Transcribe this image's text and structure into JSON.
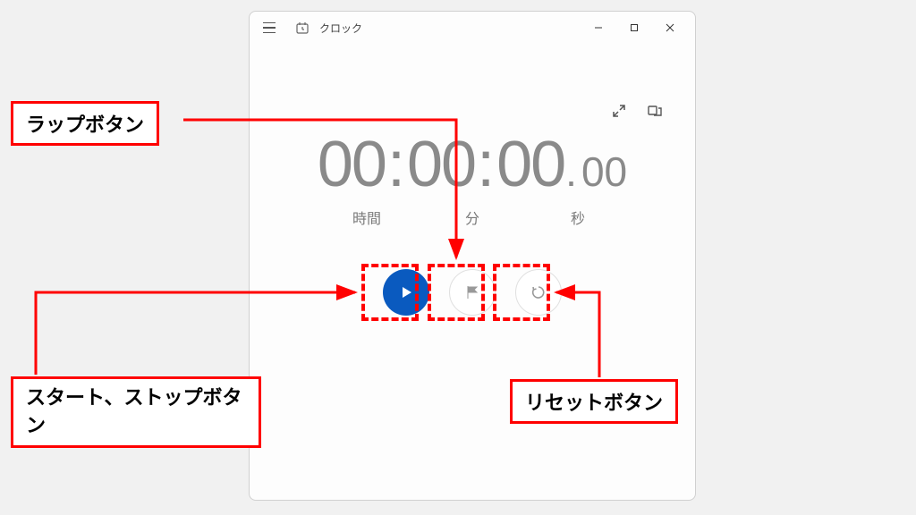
{
  "window": {
    "title": "クロック"
  },
  "stopwatch": {
    "hours": "00",
    "minutes": "00",
    "seconds": "00",
    "centiseconds": "00",
    "label_hours": "時間",
    "label_minutes": "分",
    "label_seconds": "秒"
  },
  "annotations": {
    "lap": "ラップボタン",
    "startstop": "スタート、ストップボタン",
    "reset": "リセットボタン"
  }
}
